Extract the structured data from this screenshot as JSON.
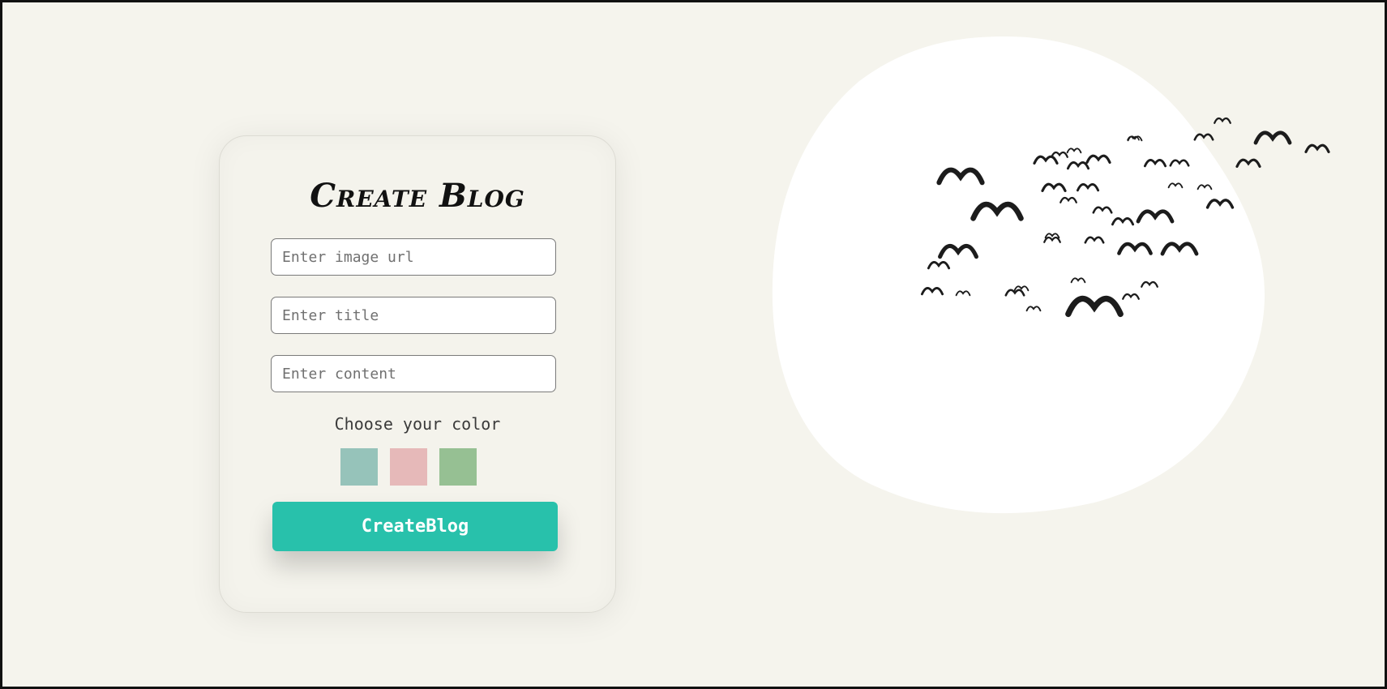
{
  "form": {
    "title": "Create Blog",
    "image_url_placeholder": "Enter image url",
    "title_placeholder": "Enter title",
    "content_placeholder": "Enter content",
    "color_label": "Choose your color",
    "swatches": [
      {
        "color": "#96c3ba"
      },
      {
        "color": "#e6b9b9"
      },
      {
        "color": "#96c093"
      }
    ],
    "submit_label": "CreateBlog",
    "submit_color": "#28c1ab"
  },
  "illustration": {
    "icon": "flock-of-birds-icon",
    "blob_color": "#ffffff",
    "bird_color": "#1c1c1c"
  }
}
